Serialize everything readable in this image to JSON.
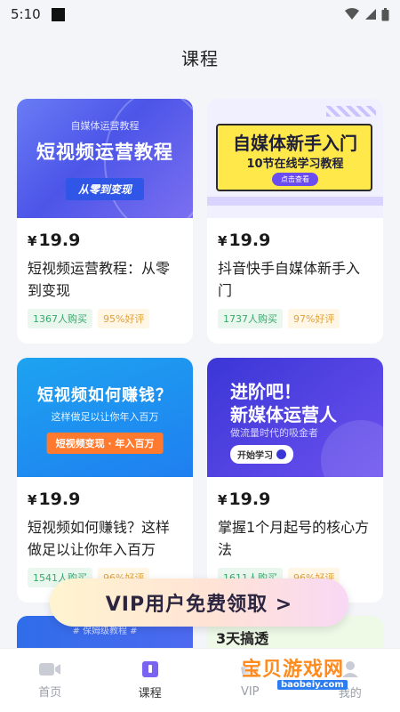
{
  "status": {
    "time": "5:10"
  },
  "header": {
    "title": "课程"
  },
  "courses": [
    {
      "thumb": {
        "sub": "自媒体运营教程",
        "main": "短视频运营教程",
        "pill": "从零到变现"
      },
      "price_symbol": "¥",
      "price": "19.9",
      "title": "短视频运营教程：从零到变现",
      "buyers": "1367人购买",
      "rating": "95%好评"
    },
    {
      "thumb": {
        "main": "自媒体新手入门",
        "sub": "10节在线学习教程",
        "btn": "点击查看"
      },
      "price_symbol": "¥",
      "price": "19.9",
      "title": "抖音快手自媒体新手入门",
      "buyers": "1737人购买",
      "rating": "97%好评"
    },
    {
      "thumb": {
        "main": "短视频如何赚钱？",
        "sub": "这样做足以让你年入百万",
        "pill": "短视频变现 · 年入百万"
      },
      "price_symbol": "¥",
      "price": "19.9",
      "title": "短视频如何赚钱？这样做足以让你年入百万",
      "buyers": "1541人购买",
      "rating": "96%好评"
    },
    {
      "thumb": {
        "main1": "进阶吧！",
        "main2": "新媒体运营人",
        "sub": "做流量时代的吸金者",
        "btn": "开始学习"
      },
      "price_symbol": "¥",
      "price": "19.9",
      "title": "掌握1个月起号的核心方法",
      "buyers": "1611人购买",
      "rating": "96%好评"
    }
  ],
  "peek": {
    "left": "# 保姆级教程 #",
    "right": "3天搞透"
  },
  "vip_banner": {
    "label": "VIP用户免费领取  >"
  },
  "tabbar": {
    "items": [
      {
        "label": "首页",
        "icon": "video-camera-icon"
      },
      {
        "label": "课程",
        "icon": "book-icon"
      },
      {
        "label": "VIP",
        "icon": "vip-icon"
      },
      {
        "label": "我的",
        "icon": "user-icon"
      }
    ],
    "active_index": 1
  },
  "watermark": {
    "big": "宝贝游戏网",
    "small": "baobeiy.com"
  },
  "colors": {
    "accent": "#6a4cf0",
    "buy_tag": "#37a96a",
    "rate_tag": "#e2a13b"
  }
}
